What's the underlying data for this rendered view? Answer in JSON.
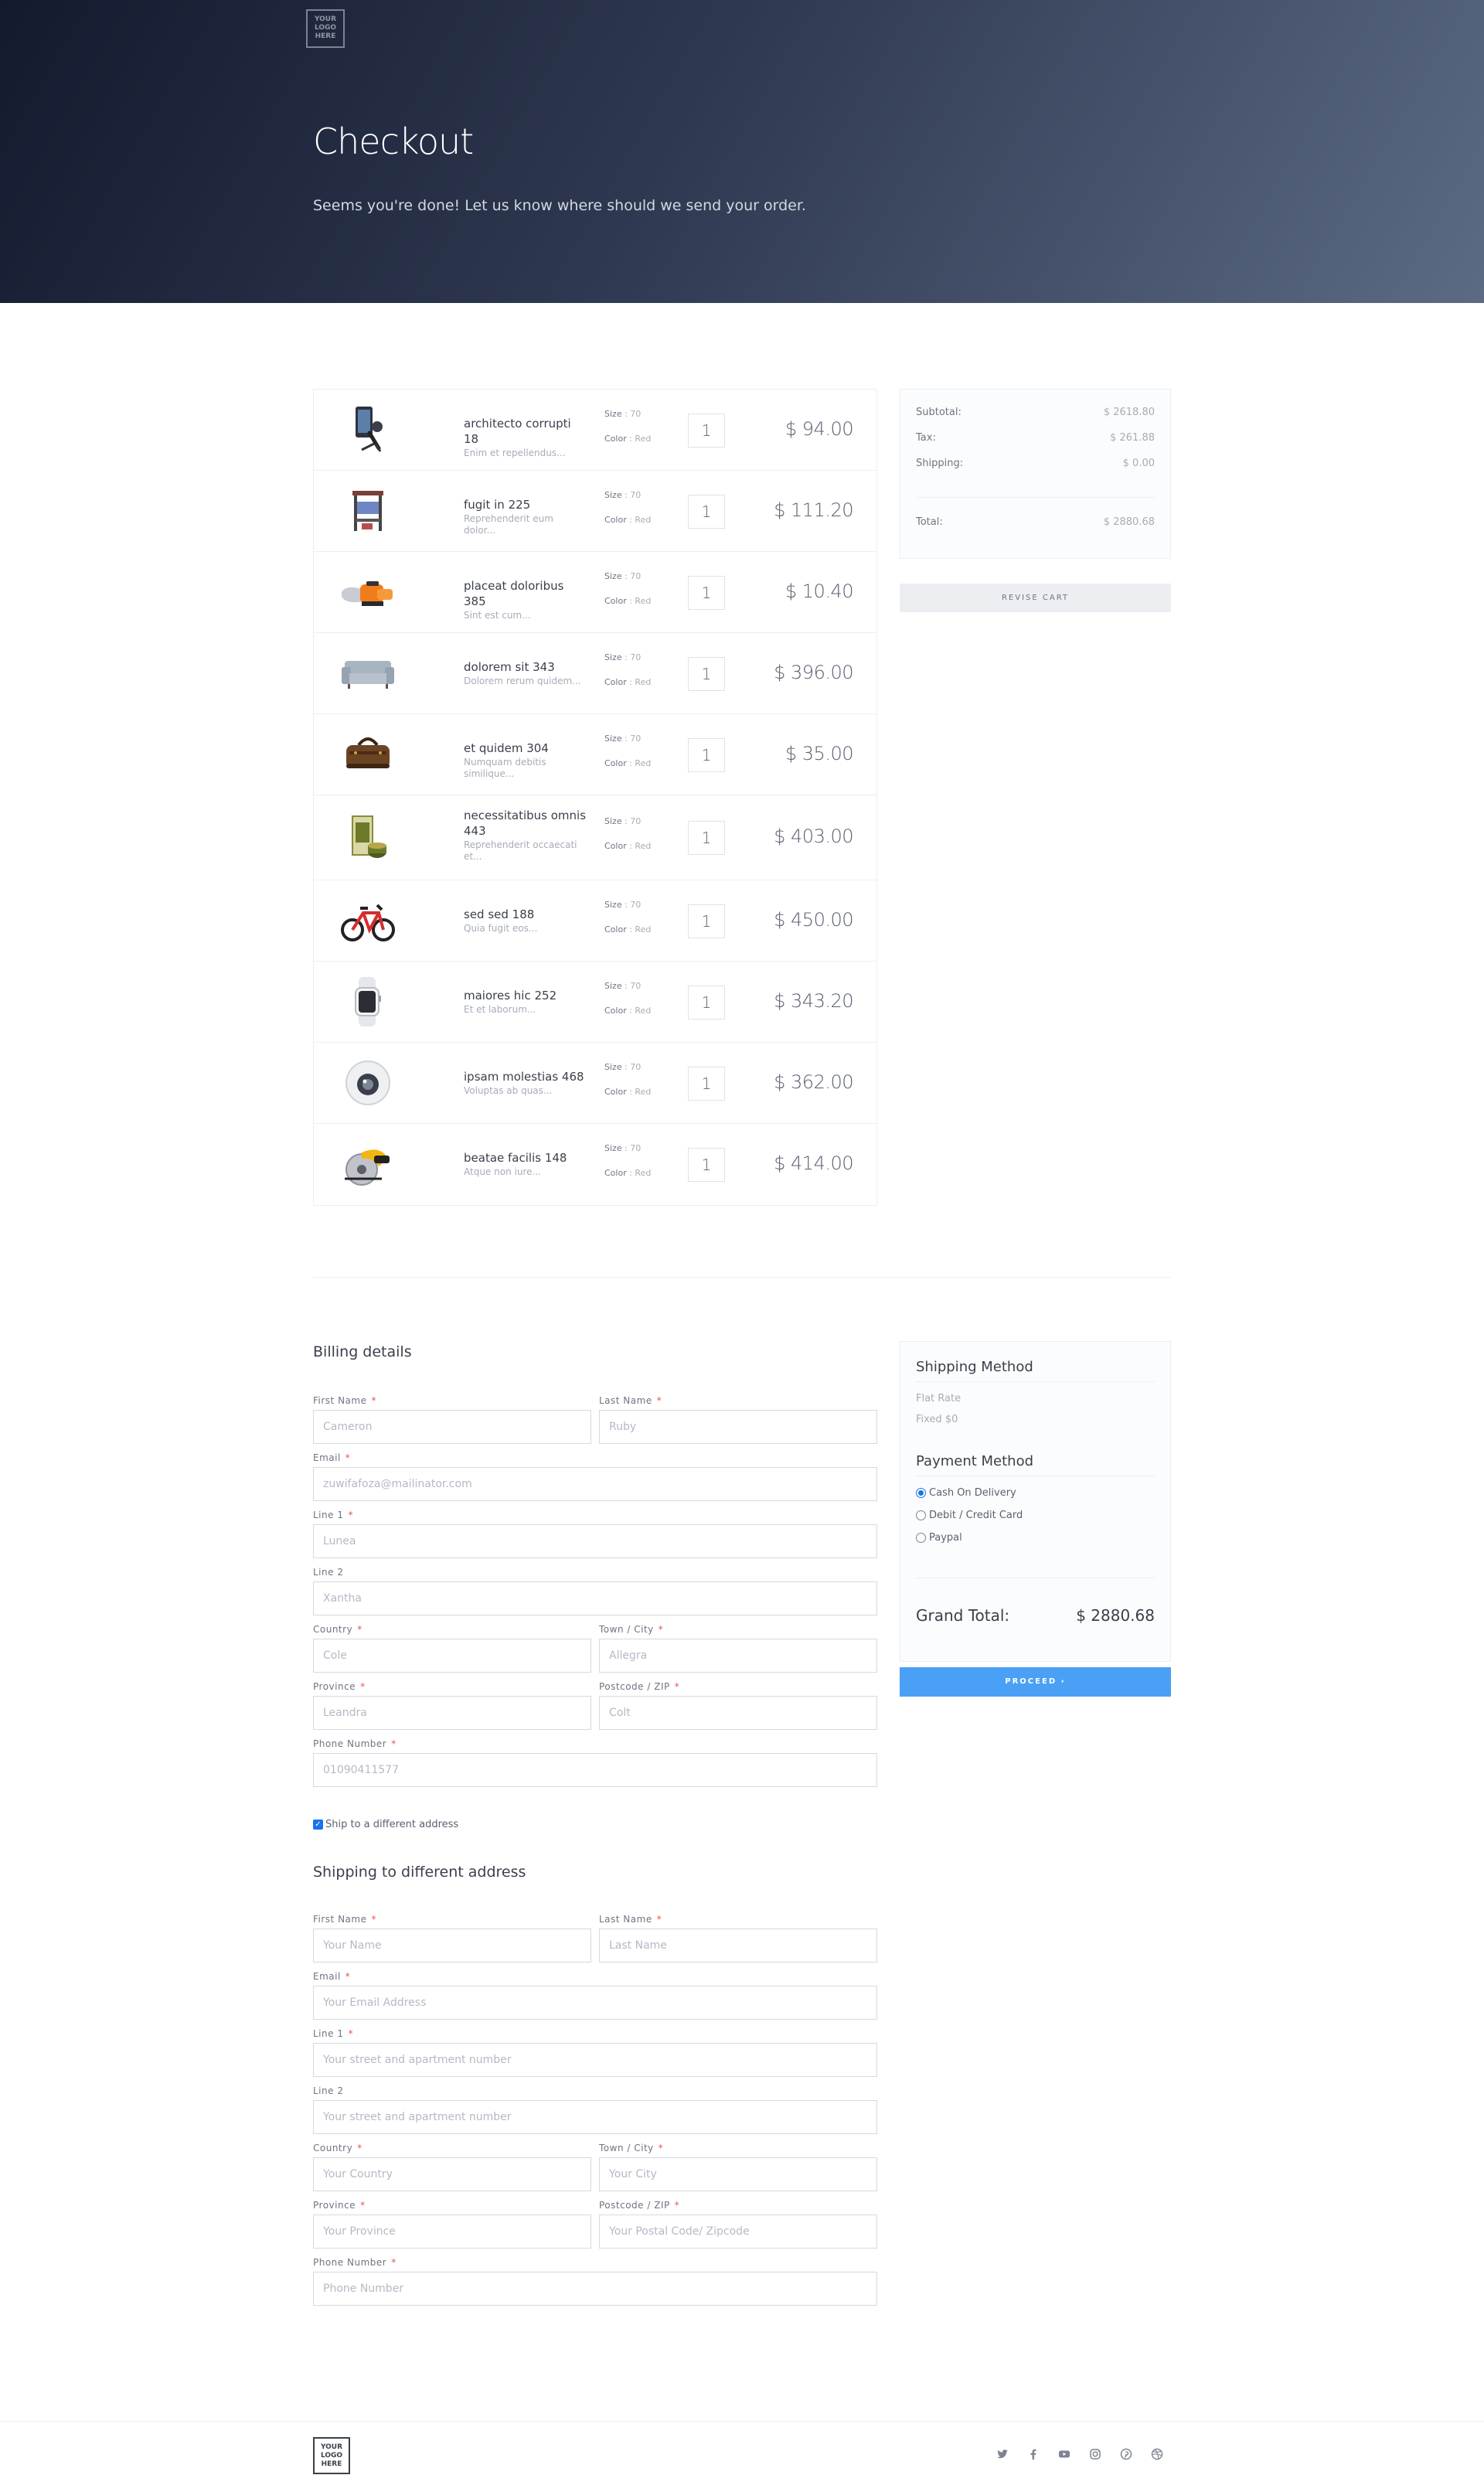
{
  "header": {
    "logo_text": "YOUR LOGO HERE",
    "title": "Checkout",
    "subtitle": "Seems you're done! Let us know where should we send your order."
  },
  "cart": {
    "attr_size_label": "Size",
    "attr_color_label": "Color",
    "items": [
      {
        "name": "architecto corrupti 18",
        "desc": "Enim et repellendus...",
        "size": ": 70",
        "color": ": Red",
        "qty": "1",
        "price": "$ 94.00",
        "icon": "smartphone-gimbal-icon"
      },
      {
        "name": "fugit in 225",
        "desc": "Reprehenderit eum dolor...",
        "size": ": 70",
        "color": ": Red",
        "qty": "1",
        "price": "$ 111.20",
        "icon": "desk-icon"
      },
      {
        "name": "placeat doloribus 385",
        "desc": "Sint est cum...",
        "size": ": 70",
        "color": ": Red",
        "qty": "1",
        "price": "$ 10.40",
        "icon": "chainsaw-icon"
      },
      {
        "name": "dolorem sit 343",
        "desc": "Dolorem rerum quidem...",
        "size": ": 70",
        "color": ": Red",
        "qty": "1",
        "price": "$ 396.00",
        "icon": "sofa-icon"
      },
      {
        "name": "et quidem 304",
        "desc": "Numquam debitis similique...",
        "size": ": 70",
        "color": ": Red",
        "qty": "1",
        "price": "$ 35.00",
        "icon": "bag-icon"
      },
      {
        "name": "necessitatibus omnis 443",
        "desc": "Reprehenderit occaecati et...",
        "size": ": 70",
        "color": ": Red",
        "qty": "1",
        "price": "$ 403.00",
        "icon": "cosmetics-icon"
      },
      {
        "name": "sed sed 188",
        "desc": "Quia fugit eos...",
        "size": ": 70",
        "color": ": Red",
        "qty": "1",
        "price": "$ 450.00",
        "icon": "bicycle-icon"
      },
      {
        "name": "maiores hic 252",
        "desc": "Et et laborum...",
        "size": ": 70",
        "color": ": Red",
        "qty": "1",
        "price": "$ 343.20",
        "icon": "smartwatch-icon"
      },
      {
        "name": "ipsam molestias 468",
        "desc": "Voluptas ab quas...",
        "size": ": 70",
        "color": ": Red",
        "qty": "1",
        "price": "$ 362.00",
        "icon": "camera-360-icon"
      },
      {
        "name": "beatae facilis 148",
        "desc": "Atque non iure...",
        "size": ": 70",
        "color": ": Red",
        "qty": "1",
        "price": "$ 414.00",
        "icon": "circular-saw-icon"
      }
    ]
  },
  "summary": {
    "subtotal_label": "Subtotal:",
    "subtotal": "$ 2618.80",
    "tax_label": "Tax:",
    "tax": "$ 261.88",
    "shipping_label": "Shipping:",
    "shipping": "$ 0.00",
    "total_label": "Total:",
    "total": "$ 2880.68",
    "revise_button": "REVISE CART"
  },
  "billing": {
    "title": "Billing details",
    "first_name_label": "First Name",
    "first_name": "Cameron",
    "last_name_label": "Last Name",
    "last_name": "Ruby",
    "email_label": "Email",
    "email": "zuwifafoza@mailinator.com",
    "line1_label": "Line 1",
    "line1": "Lunea",
    "line2_label": "Line 2",
    "line2": "Xantha",
    "country_label": "Country",
    "country": "Cole",
    "city_label": "Town / City",
    "city": "Allegra",
    "province_label": "Province",
    "province": "Leandra",
    "postcode_label": "Postcode / ZIP",
    "postcode": "Colt",
    "phone_label": "Phone Number",
    "phone": "01090411577"
  },
  "ship_different_label": "Ship to a different address",
  "shipping": {
    "title": "Shipping to different address",
    "first_name_label": "First Name",
    "first_name_ph": "Your Name",
    "last_name_label": "Last Name",
    "last_name_ph": "Last Name",
    "email_label": "Email",
    "email_ph": "Your Email Address",
    "line1_label": "Line 1",
    "line1_ph": "Your street and apartment number",
    "line2_label": "Line 2",
    "line2_ph": "Your street and apartment number",
    "country_label": "Country",
    "country_ph": "Your Country",
    "city_label": "Town / City",
    "city_ph": "Your City",
    "province_label": "Province",
    "province_ph": "Your Province",
    "postcode_label": "Postcode / ZIP",
    "postcode_ph": "Your Postal Code/ Zipcode",
    "phone_label": "Phone Number",
    "phone_ph": "Phone Number"
  },
  "required_mark": "*",
  "methods": {
    "shipping_title": "Shipping Method",
    "shipping_name": "Flat Rate",
    "shipping_price": "Fixed $0",
    "payment_title": "Payment Method",
    "payment_options": [
      "Cash On Delivery",
      "Debit / Credit Card",
      "Paypal"
    ],
    "selected_payment": "Cash On Delivery",
    "grand_total_label": "Grand Total:",
    "grand_total": "$ 2880.68",
    "proceed_button": "PROCEED ›"
  },
  "footer": {
    "logo_text": "YOUR LOGO HERE",
    "social_icons": [
      "twitter-icon",
      "facebook-icon",
      "youtube-icon",
      "instagram-icon",
      "pinterest-icon",
      "dribbble-icon"
    ]
  },
  "colors": {
    "hero_dark": "#131a2e",
    "hero_light": "#5c6a84",
    "accent": "#4aa0f5",
    "required": "#e8524a"
  }
}
